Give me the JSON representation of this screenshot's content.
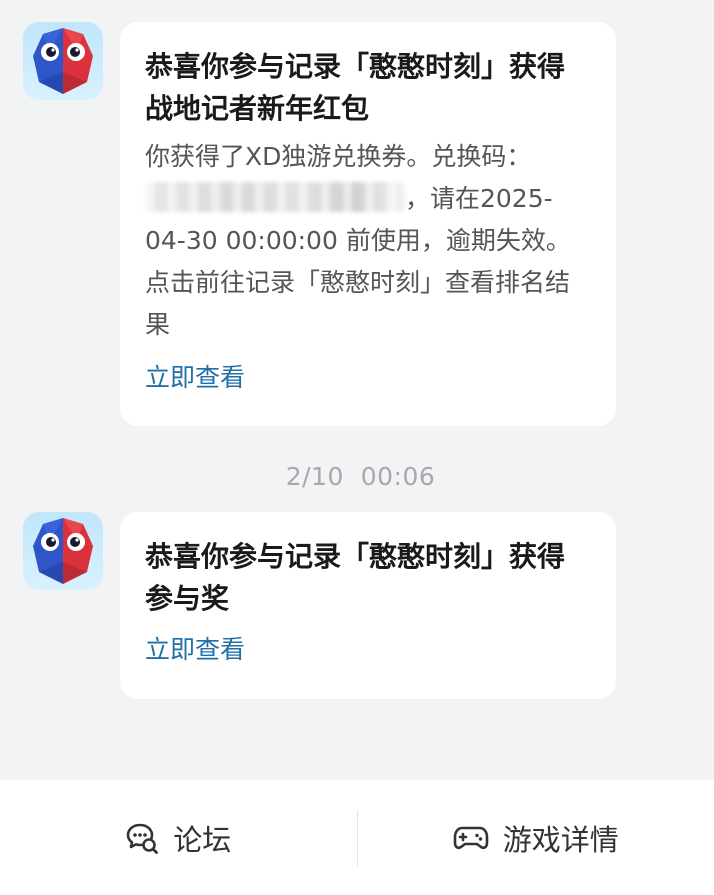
{
  "messages": [
    {
      "title": "恭喜你参与记录「憨憨时刻」获得战地记者新年红包",
      "body_part1": "你获得了XD独游兑换券。兑换码：",
      "body_part2": "，请在2025-04-30 00:00:00 前使用，逾期失效。点击前往记录「憨憨时刻」查看排名结果",
      "link_label": "立即查看",
      "avatar_icon": "red-blue-mascot-icon"
    },
    {
      "title": "恭喜你参与记录「憨憨时刻」获得参与奖",
      "link_label": "立即查看",
      "avatar_icon": "red-blue-mascot-icon"
    }
  ],
  "timestamp": "2/10  00:06",
  "bottom_bar": {
    "forum_label": "论坛",
    "forum_icon": "forum-chat-icon",
    "game_details_label": "游戏详情",
    "game_details_icon": "gamepad-icon"
  },
  "colors": {
    "background": "#f2f3f5",
    "card": "#ffffff",
    "link": "#1f6fa8",
    "timestamp": "#a7a8ac",
    "mascot_red": "#d9323c",
    "mascot_blue": "#2f56c8"
  }
}
